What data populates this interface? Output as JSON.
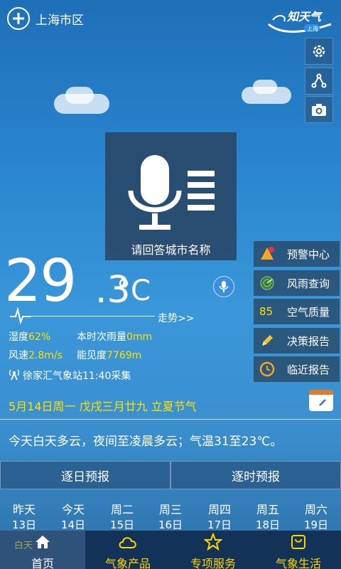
{
  "header": {
    "city": "上海市区",
    "logo_text": "知天气",
    "logo_sub": "上海"
  },
  "voice": {
    "hint": "请回答城市名称"
  },
  "weather": {
    "temp_int": "29",
    "temp_dec": ".3",
    "temp_unit": "°C",
    "trend_label": "走势>>",
    "humidity_label": "湿度",
    "humidity_value": "62%",
    "rain_label": "本时次雨量",
    "rain_value": "0mm",
    "wind_label": "风速",
    "wind_value": "2.8m/s",
    "visibility_label": "能见度",
    "visibility_value": "7769m",
    "station": "徐家汇气象站11:40采集"
  },
  "menu": {
    "items": [
      {
        "label": "预警中心",
        "icon": "warning-icon"
      },
      {
        "label": "风雨查询",
        "icon": "radar-icon"
      },
      {
        "label": "空气质量",
        "icon": "aqi-icon",
        "badge": "85"
      },
      {
        "label": "决策报告",
        "icon": "pencil-icon"
      },
      {
        "label": "临近报告",
        "icon": "clock-icon"
      }
    ]
  },
  "date_line": "5月14日周一   戊戌三月廿九   立夏节气",
  "summary": "今天白天多云，夜间至凌晨多云；气温31至23℃。",
  "forecast": {
    "tabs": [
      "逐日预报",
      "逐时预报"
    ],
    "days": [
      {
        "day": "昨天",
        "date": "13日"
      },
      {
        "day": "今天",
        "date": "14日"
      },
      {
        "day": "周二",
        "date": "15日"
      },
      {
        "day": "周三",
        "date": "16日"
      },
      {
        "day": "周四",
        "date": "17日"
      },
      {
        "day": "周五",
        "date": "18日"
      },
      {
        "day": "周六",
        "date": "19日"
      }
    ],
    "daytime_label": "白天"
  },
  "bottom_nav": {
    "items": [
      {
        "label": "首页",
        "icon": "home-icon"
      },
      {
        "label": "气象产品",
        "icon": "cloud-icon"
      },
      {
        "label": "专项服务",
        "icon": "star-icon"
      },
      {
        "label": "气象生活",
        "icon": "bag-icon"
      }
    ]
  },
  "colors": {
    "highlight": "#ffe000",
    "nav_inactive": "#ffd500",
    "accent": "#3a8fe0"
  }
}
